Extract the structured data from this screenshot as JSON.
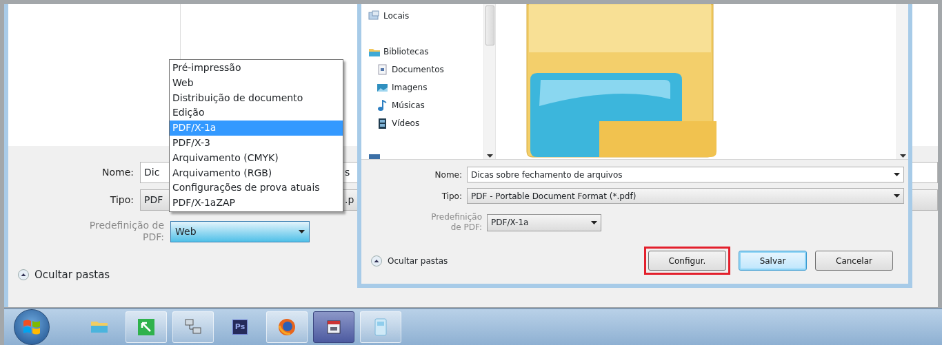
{
  "back_dialog": {
    "fields": [
      {
        "kind": "edit",
        "label": "Nome:",
        "value": "Dic",
        "tail": "s"
      },
      {
        "kind": "type",
        "label": "Tipo:",
        "value": "PDF",
        "tail": ".p"
      }
    ],
    "preset": {
      "label": "Predefinição de PDF:",
      "value": "Web",
      "focused": true
    },
    "hide_folders": "Ocultar pastas"
  },
  "preset_menu": [
    {
      "label": "Pré-impressão",
      "selected": false
    },
    {
      "label": "Web",
      "selected": false
    },
    {
      "label": "Distribuição de documento",
      "selected": false
    },
    {
      "label": "Edição",
      "selected": false
    },
    {
      "label": "PDF/X-1a",
      "selected": true
    },
    {
      "label": "PDF/X-3",
      "selected": false
    },
    {
      "label": "Arquivamento (CMYK)",
      "selected": false
    },
    {
      "label": "Arquivamento (RGB)",
      "selected": false
    },
    {
      "label": "Configurações de prova atuais",
      "selected": false
    },
    {
      "label": "PDF/X-1aZAP",
      "selected": false
    }
  ],
  "front_dialog": {
    "nav": [
      {
        "kind": "places",
        "label": "Locais"
      },
      {
        "kind": "library",
        "label": "Bibliotecas",
        "children": [
          {
            "kind": "documents",
            "label": "Documentos"
          },
          {
            "kind": "pictures",
            "label": "Imagens"
          },
          {
            "kind": "music",
            "label": "Músicas"
          },
          {
            "kind": "videos",
            "label": "Vídeos"
          }
        ]
      },
      {
        "kind": "computer"
      }
    ],
    "fields": [
      {
        "kind": "edit",
        "label": "Nome:",
        "value": "Dicas sobre fechamento de arquivos"
      },
      {
        "kind": "type",
        "label": "Tipo:",
        "value": "PDF - Portable Document Format (*.pdf)"
      }
    ],
    "preset": {
      "label": "Predefinição de PDF:",
      "value": "PDF/X-1a",
      "focused": false
    },
    "hide_folders": "Ocultar pastas",
    "buttons": [
      {
        "label": "Configur.",
        "highlighted": true,
        "default": false
      },
      {
        "label": "Salvar",
        "highlighted": false,
        "default": true
      },
      {
        "label": "Cancelar",
        "highlighted": false,
        "default": false
      }
    ]
  },
  "taskbar": {
    "apps": [
      {
        "kind": "folder",
        "selected": false
      },
      {
        "kind": "green",
        "selected": false
      },
      {
        "kind": "network",
        "selected": false
      },
      {
        "kind": "ps",
        "label": "Ps",
        "selected": false
      },
      {
        "kind": "browser",
        "selected": false
      },
      {
        "kind": "calendar",
        "selected": true
      },
      {
        "kind": "page",
        "selected": false
      }
    ]
  }
}
